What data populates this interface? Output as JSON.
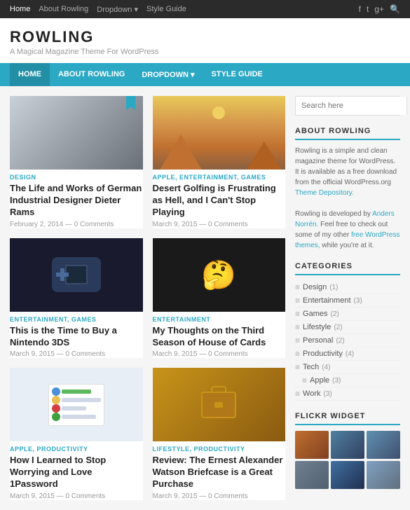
{
  "topNav": {
    "items": [
      {
        "label": "Home",
        "active": true
      },
      {
        "label": "About Rowling",
        "active": false
      },
      {
        "label": "Dropdown ▾",
        "active": false
      },
      {
        "label": "Style Guide",
        "active": false
      }
    ]
  },
  "siteHeader": {
    "title": "ROWLING",
    "tagline": "A Magical Magazine Theme For WordPress"
  },
  "mainNav": {
    "items": [
      {
        "label": "HOME",
        "active": true
      },
      {
        "label": "ABOUT ROWLING",
        "active": false
      },
      {
        "label": "DROPDOWN ▾",
        "active": false
      },
      {
        "label": "STYLE GUIDE",
        "active": false
      }
    ]
  },
  "posts": [
    {
      "id": 1,
      "category": "DESIGN",
      "title": "The Life and Works of German Industrial Designer Dieter Rams",
      "date": "February 2, 2014 — 0 Comments",
      "thumb": "design",
      "hasBookmark": true
    },
    {
      "id": 2,
      "category": "APPLE, ENTERTAINMENT, GAMES",
      "title": "Desert Golfing is Frustrating as Hell, and I Can't Stop Playing",
      "date": "March 9, 2015 — 0 Comments",
      "thumb": "desert",
      "hasBookmark": false
    },
    {
      "id": 3,
      "category": "ENTERTAINMENT, GAMES",
      "title": "This is the Time to Buy a Nintendo 3DS",
      "date": "March 9, 2015 — 0 Comments",
      "thumb": "nintendo",
      "hasBookmark": false
    },
    {
      "id": 4,
      "category": "ENTERTAINMENT",
      "title": "My Thoughts on the Third Season of House of Cards",
      "date": "March 9, 2015 — 0 Comments",
      "thumb": "hoc",
      "hasBookmark": false
    },
    {
      "id": 5,
      "category": "APPLE, PRODUCTIVITY",
      "title": "How I Learned to Stop Worrying and Love 1Password",
      "date": "March 9, 2015 — 0 Comments",
      "thumb": "password",
      "hasBookmark": false
    },
    {
      "id": 6,
      "category": "LIFESTYLE, PRODUCTIVITY",
      "title": "Review: The Ernest Alexander Watson Briefcase is a Great Purchase",
      "date": "March 9, 2015 — 0 Comments",
      "thumb": "briefcase",
      "hasBookmark": false
    }
  ],
  "sidebar": {
    "searchPlaceholder": "Search here",
    "aboutTitle": "ABOUT ROWLING",
    "aboutText1": "Rowling is a simple and clean magazine theme for WordPress. It is available as a free download from the official WordPress.org",
    "aboutLink1": "Theme Depository.",
    "aboutText2": "Rowling is developed by",
    "aboutLink2": "Anders Norrén.",
    "aboutText3": "Feel free to check out some of my other",
    "aboutLink3": "free WordPress themes,",
    "aboutText4": "while you're at it.",
    "categoriesTitle": "CATEGORIES",
    "categories": [
      {
        "name": "Design",
        "count": "(1)"
      },
      {
        "name": "Entertainment",
        "count": "(3)"
      },
      {
        "name": "Games",
        "count": "(2)"
      },
      {
        "name": "Lifestyle",
        "count": "(2)"
      },
      {
        "name": "Personal",
        "count": "(2)"
      },
      {
        "name": "Productivity",
        "count": "(4)"
      },
      {
        "name": "Tech",
        "count": "(4)"
      },
      {
        "name": "Apple",
        "count": "(3)"
      },
      {
        "name": "Work",
        "count": "(3)"
      }
    ],
    "flickrTitle": "FLICKR WIDGET"
  }
}
